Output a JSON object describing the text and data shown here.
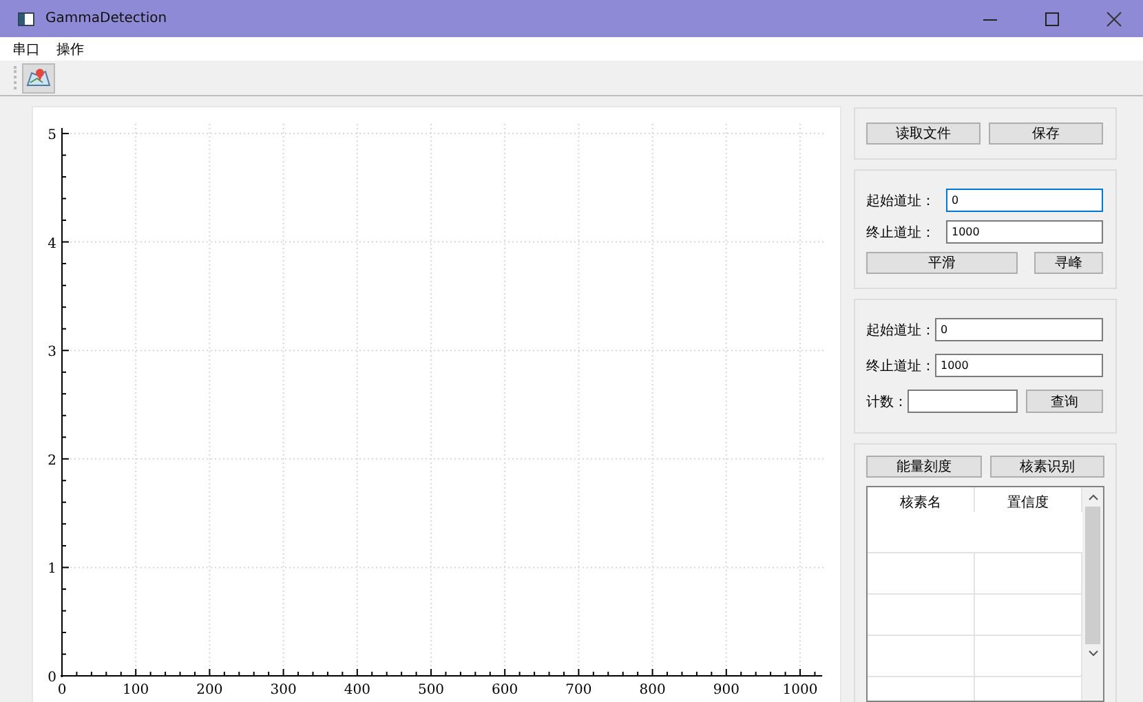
{
  "window": {
    "title": "GammaDetection"
  },
  "menu": [
    {
      "label": "串口"
    },
    {
      "label": "操作"
    }
  ],
  "chart": {
    "chart_data": {
      "type": "line",
      "grid": true,
      "xlim": [
        0,
        1030
      ],
      "ylim": [
        0,
        5
      ],
      "xticks": [
        0,
        100,
        200,
        300,
        400,
        500,
        600,
        700,
        800,
        900,
        1000
      ],
      "yticks": [
        0,
        1,
        2,
        3,
        4,
        5
      ]
    }
  },
  "file_panel": {
    "buttons": [
      "读取文件",
      "保存"
    ]
  },
  "smooth_panel": {
    "fields": [
      {
        "label": "起始道址：",
        "value": "0",
        "focused": true
      },
      {
        "label": "终止道址：",
        "value": "1000",
        "focused": false
      }
    ],
    "buttons": [
      "平滑",
      "寻峰"
    ]
  },
  "query_panel": {
    "fields": [
      {
        "label": "起始道址：",
        "value": "0",
        "focused": false
      },
      {
        "label": "终止道址：",
        "value": "1000",
        "focused": false
      }
    ],
    "count_label": "计数：",
    "button": "查询"
  },
  "identify_panel": {
    "buttons": [
      "能量刻度",
      "核素识别"
    ],
    "columns": [
      "核素名",
      "置信度"
    ]
  }
}
